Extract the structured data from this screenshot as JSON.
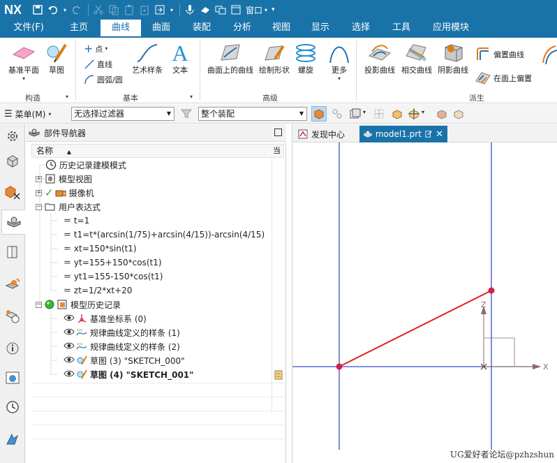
{
  "app": {
    "logo": "NX",
    "window_menu": "窗口"
  },
  "menu_tabs": [
    "文件(F)",
    "主页",
    "曲线",
    "曲面",
    "装配",
    "分析",
    "视图",
    "显示",
    "选择",
    "工具",
    "应用模块"
  ],
  "active_tab": "曲线",
  "ribbon": {
    "datum_plane": "基准平面",
    "sketch": "草图",
    "point": "点",
    "line": "直线",
    "arc_circle": "圆弧/圆",
    "studio_spline": "艺术样条",
    "text": "文本",
    "curve_on_surface": "曲面上的曲线",
    "sketch_shape": "绘制形状",
    "helix": "螺旋",
    "more": "更多",
    "project_curve": "投影曲线",
    "intersect_curve": "相交曲线",
    "shadow_curve": "阴影曲线",
    "offset_curve": "偏置曲线",
    "offset_on_face": "在面上偏置",
    "groups": {
      "construct": "构造",
      "basic": "基本",
      "advanced": "高级",
      "derived": "派生"
    }
  },
  "toolbar": {
    "menu": "菜单(M)",
    "filter": "无选择过滤器",
    "assembly": "整个装配"
  },
  "navigator": {
    "title": "部件导航器",
    "column": "名称",
    "column_right": "当",
    "rows": [
      {
        "label": "历史记录建模模式"
      },
      {
        "label": "模型视图"
      },
      {
        "label": "摄像机"
      },
      {
        "label": "用户表达式"
      },
      {
        "label": "t=1"
      },
      {
        "label": "t1=t*(arcsin(1/75)+arcsin(4/15))-arcsin(4/15)"
      },
      {
        "label": "xt=150*sin(t1)"
      },
      {
        "label": "yt=155+150*cos(t1)"
      },
      {
        "label": "yt1=155-150*cos(t1)"
      },
      {
        "label": "zt=1/2*xt+20"
      },
      {
        "label": "模型历史记录"
      },
      {
        "label": "基准坐标系 (0)"
      },
      {
        "label": "规律曲线定义的样条 (1)"
      },
      {
        "label": "规律曲线定义的样条 (2)"
      },
      {
        "label": "草图 (3) \"SKETCH_000\""
      },
      {
        "label": "草图 (4) \"SKETCH_001\""
      }
    ]
  },
  "graphics": {
    "tabs": [
      "发现中心",
      "model1.prt"
    ],
    "axis_x": "X",
    "axis_z": "Z",
    "colors": {
      "curve": "#e02020",
      "guide": "#3a4fc8",
      "point": "#d0204a"
    }
  },
  "watermark": "UG爱好者论坛@pzhzshun"
}
